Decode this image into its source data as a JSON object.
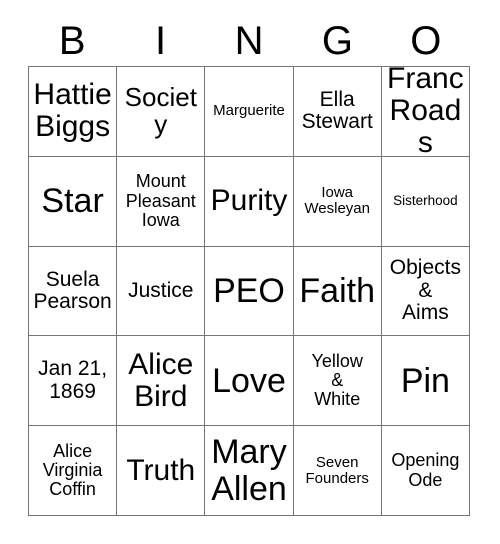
{
  "card": {
    "header_letters": [
      "B",
      "I",
      "N",
      "G",
      "O"
    ],
    "colors": {
      "text": "#000000",
      "grid_line": "#757575",
      "cell_background": "#ffffff",
      "page_background": "#ffffff"
    },
    "rows": [
      [
        {
          "text": "Hattie\nBiggs",
          "size": "fs-xl"
        },
        {
          "text": "Society",
          "size": "fs-lg"
        },
        {
          "text": "Marguerite",
          "size": "fs-xs"
        },
        {
          "text": "Ella\nStewart",
          "size": "fs-md"
        },
        {
          "text": "Franc\nRoads",
          "size": "fs-xl"
        }
      ],
      [
        {
          "text": "Star",
          "size": "fs-xxl"
        },
        {
          "text": "Mount\nPleasant\nIowa",
          "size": "fs-sm"
        },
        {
          "text": "Purity",
          "size": "fs-xl"
        },
        {
          "text": "Iowa\nWesleyan",
          "size": "fs-xs"
        },
        {
          "text": "Sisterhood",
          "size": "fs-xxs"
        }
      ],
      [
        {
          "text": "Suela\nPearson",
          "size": "fs-md"
        },
        {
          "text": "Justice",
          "size": "fs-md"
        },
        {
          "text": "PEO",
          "size": "fs-xxl"
        },
        {
          "text": "Faith",
          "size": "fs-xxl"
        },
        {
          "text": "Objects\n&\nAims",
          "size": "fs-md"
        }
      ],
      [
        {
          "text": "Jan 21,\n1869",
          "size": "fs-md"
        },
        {
          "text": "Alice\nBird",
          "size": "fs-xl"
        },
        {
          "text": "Love",
          "size": "fs-xxl"
        },
        {
          "text": "Yellow\n&\nWhite",
          "size": "fs-sm"
        },
        {
          "text": "Pin",
          "size": "fs-xxl"
        }
      ],
      [
        {
          "text": "Alice\nVirginia\nCoffin",
          "size": "fs-sm"
        },
        {
          "text": "Truth",
          "size": "fs-xl"
        },
        {
          "text": "Mary\nAllen",
          "size": "fs-xxl"
        },
        {
          "text": "Seven\nFounders",
          "size": "fs-xs"
        },
        {
          "text": "Opening\nOde",
          "size": "fs-sm"
        }
      ]
    ]
  }
}
